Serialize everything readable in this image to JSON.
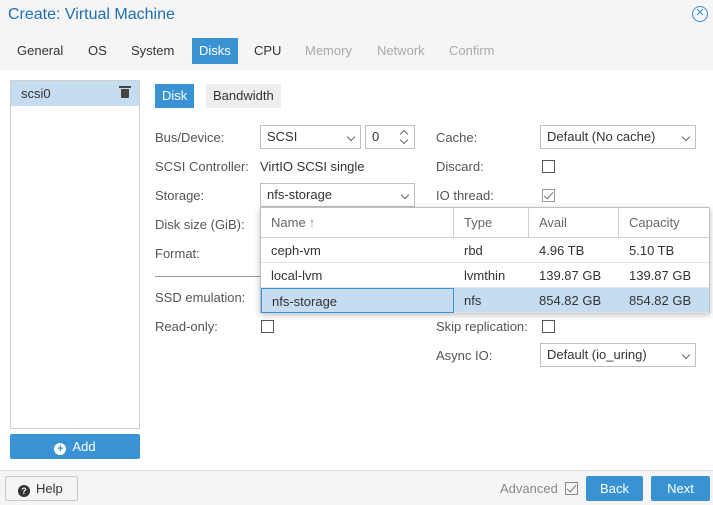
{
  "window": {
    "title": "Create: Virtual Machine",
    "close_icon": "close-icon"
  },
  "tabs": [
    {
      "label": "General",
      "state": "normal"
    },
    {
      "label": "OS",
      "state": "normal"
    },
    {
      "label": "System",
      "state": "normal"
    },
    {
      "label": "Disks",
      "state": "active"
    },
    {
      "label": "CPU",
      "state": "normal"
    },
    {
      "label": "Memory",
      "state": "disabled"
    },
    {
      "label": "Network",
      "state": "disabled"
    },
    {
      "label": "Confirm",
      "state": "disabled"
    }
  ],
  "disk_list": {
    "items": [
      {
        "label": "scsi0",
        "icon": "trash-icon"
      }
    ],
    "add_label": "Add"
  },
  "subtabs": {
    "disk": "Disk",
    "bandwidth": "Bandwidth"
  },
  "form": {
    "bus_device_label": "Bus/Device:",
    "bus_value": "SCSI",
    "device_number": "0",
    "scsi_controller_label": "SCSI Controller:",
    "scsi_controller_value": "VirtIO SCSI single",
    "storage_label": "Storage:",
    "storage_value": "nfs-storage",
    "disk_size_label": "Disk size (GiB):",
    "format_label": "Format:",
    "ssd_emulation_label": "SSD emulation:",
    "readonly_label": "Read-only:",
    "cache_label": "Cache:",
    "cache_value": "Default (No cache)",
    "discard_label": "Discard:",
    "iothread_label": "IO thread:",
    "skip_replication_label": "Skip replication:",
    "async_io_label": "Async IO:",
    "async_io_value": "Default (io_uring)"
  },
  "storage_picker": {
    "columns": [
      "Name",
      "Type",
      "Avail",
      "Capacity"
    ],
    "sort_indicator": "↑",
    "rows": [
      {
        "name": "ceph-vm",
        "type": "rbd",
        "avail": "4.96 TB",
        "capacity": "5.10 TB",
        "selected": false
      },
      {
        "name": "local-lvm",
        "type": "lvmthin",
        "avail": "139.87 GB",
        "capacity": "139.87 GB",
        "selected": false
      },
      {
        "name": "nfs-storage",
        "type": "nfs",
        "avail": "854.82 GB",
        "capacity": "854.82 GB",
        "selected": true
      }
    ]
  },
  "footer": {
    "help": "Help",
    "advanced": "Advanced",
    "back": "Back",
    "next": "Next"
  },
  "colors": {
    "accent": "#3892d4",
    "selection": "#c6dcf0",
    "title": "#1f6fb2"
  }
}
